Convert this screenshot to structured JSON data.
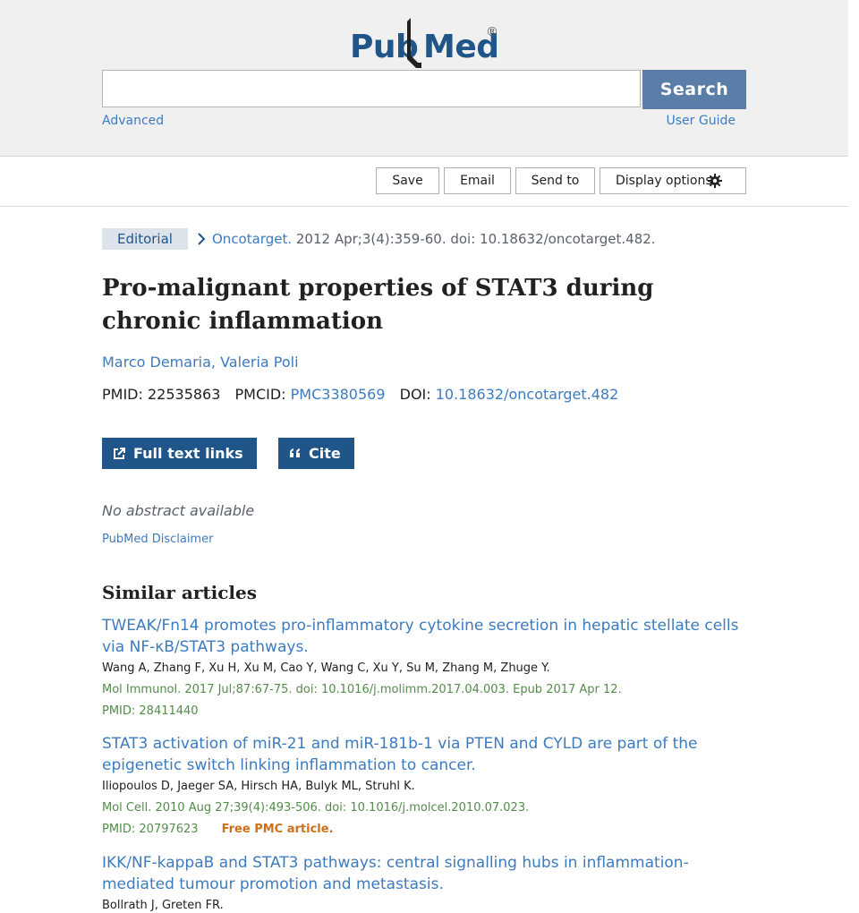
{
  "header": {
    "logo_left": "Pub",
    "logo_right": "Med",
    "logo_reg": "®",
    "search_placeholder": "",
    "search_value": "",
    "search_button": "Search",
    "advanced": "Advanced",
    "user_guide": "User Guide"
  },
  "toolbar": {
    "save": "Save",
    "email": "Email",
    "send_to": "Send to",
    "display_options": "Display options"
  },
  "article": {
    "type": "Editorial",
    "journal": "Oncotarget.",
    "citation": " 2012 Apr;3(4):359-60. doi: 10.18632/oncotarget.482.",
    "title": "Pro-malignant properties of STAT3 during chronic inflammation",
    "authors": [
      "Marco Demaria",
      "Valeria Poli"
    ],
    "pmid_label": "PMID: ",
    "pmid": "22535863",
    "pmcid_label": "PMCID: ",
    "pmcid": "PMC3380569",
    "doi_label": "DOI: ",
    "doi": "10.18632/oncotarget.482",
    "full_text_links": "Full text links",
    "cite": "Cite",
    "no_abstract": "No abstract available",
    "disclaimer": "PubMed Disclaimer"
  },
  "similar": {
    "heading": "Similar articles",
    "items": [
      {
        "title": "TWEAK/Fn14 promotes pro-inflammatory cytokine secretion in hepatic stellate cells via NF-κB/STAT3 pathways.",
        "authors": "Wang A, Zhang F, Xu H, Xu M, Cao Y, Wang C, Xu Y, Su M, Zhang M, Zhuge Y.",
        "journal": "Mol Immunol. 2017 Jul;87:67-75. doi: 10.1016/j.molimm.2017.04.003. Epub 2017 Apr 12.",
        "pmid": "PMID: 28411440",
        "free": ""
      },
      {
        "title": "STAT3 activation of miR-21 and miR-181b-1 via PTEN and CYLD are part of the epigenetic switch linking inflammation to cancer.",
        "authors": "Iliopoulos D, Jaeger SA, Hirsch HA, Bulyk ML, Struhl K.",
        "journal": "Mol Cell. 2010 Aug 27;39(4):493-506. doi: 10.1016/j.molcel.2010.07.023.",
        "pmid": "PMID: 20797623",
        "free": "Free PMC article."
      },
      {
        "title": "IKK/NF-kappaB and STAT3 pathways: central signalling hubs in inflammation-mediated tumour promotion and metastasis.",
        "authors": "Bollrath J, Greten FR.",
        "journal": "",
        "pmid": "",
        "free": ""
      }
    ]
  },
  "colors": {
    "link": "#3d7bbf",
    "brand": "#20558a",
    "search_button": "#5b7ea9",
    "journal_green": "#548c4a",
    "free_orange": "#cd7119"
  },
  "icons": [
    "pubmed-logo",
    "chevron-right-icon",
    "gear-icon",
    "external-link-icon",
    "quote-icon"
  ]
}
